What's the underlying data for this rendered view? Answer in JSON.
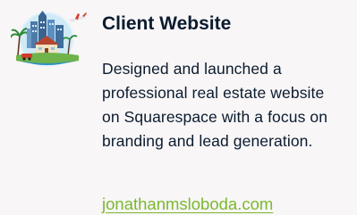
{
  "card": {
    "title": "Client Website",
    "description": "Designed and launched a professional real estate website on Squarespace with a focus on branding and lead generation.",
    "link_text": "jonathanmsloboda.com"
  },
  "logo": {
    "icon": "city-skyline-illustration-icon"
  },
  "colors": {
    "background": "#f8f6f7",
    "text": "#0b1b2e",
    "link": "#7cb82f"
  }
}
